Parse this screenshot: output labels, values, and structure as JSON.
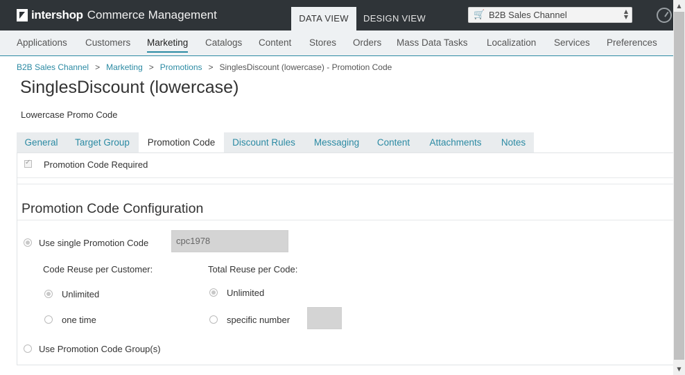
{
  "app": {
    "brand": "intershop",
    "product": "Commerce Management"
  },
  "views": {
    "data_view": "DATA VIEW",
    "design_view": "DESIGN VIEW"
  },
  "channel_select": {
    "value": "B2B Sales Channel"
  },
  "main_nav": [
    "Applications",
    "Customers",
    "Marketing",
    "Catalogs",
    "Content",
    "Stores",
    "Orders",
    "Mass Data Tasks",
    "Localization",
    "Services",
    "Preferences"
  ],
  "main_nav_active": "Marketing",
  "breadcrumb": [
    "B2B Sales Channel",
    "Marketing",
    "Promotions",
    "SinglesDiscount (lowercase) - Promotion Code"
  ],
  "breadcrumb_sep": ">",
  "page": {
    "title": "SinglesDiscount (lowercase)",
    "subtitle": "Lowercase Promo Code"
  },
  "tabs": [
    "General",
    "Target Group",
    "Promotion Code",
    "Discount Rules",
    "Messaging",
    "Content",
    "Attachments",
    "Notes"
  ],
  "tabs_active": "Promotion Code",
  "required": {
    "label": "Promotion Code Required",
    "checked": true
  },
  "config": {
    "title": "Promotion Code Configuration",
    "single_label": "Use single Promotion Code",
    "single_value": "cpc1978",
    "reuse_customer_label": "Code Reuse per Customer:",
    "reuse_total_label": "Total Reuse per Code:",
    "unlimited": "Unlimited",
    "one_time": "one time",
    "specific_number": "specific number",
    "group_label": "Use Promotion Code Group(s)"
  },
  "colors": {
    "topbar": "#2f3438",
    "accent": "#2b8aa3",
    "nav_bg": "#eef1f3"
  }
}
